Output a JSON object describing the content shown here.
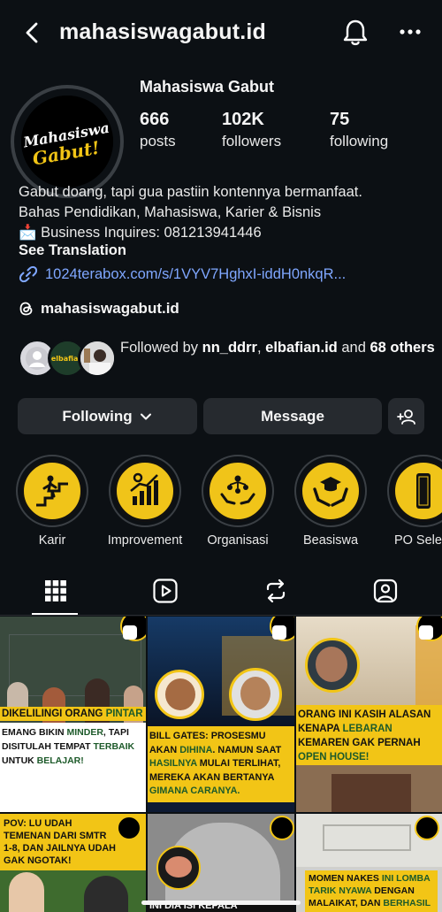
{
  "header": {
    "username": "mahasiswagabut.id"
  },
  "profile": {
    "display_name": "Mahasiswa Gabut",
    "avatar_text_1": "Mahasiswa",
    "avatar_text_2": "Gabut!",
    "stats": [
      {
        "value": "666",
        "label": "posts"
      },
      {
        "value": "102K",
        "label": "followers"
      },
      {
        "value": "75",
        "label": "following"
      }
    ],
    "bio_lines": [
      "Gabut doang, tapi gua pastiin kontennya bermanfaat.",
      "Bahas Pendidikan, Mahasiswa, Karier & Bisnis",
      "📩 Business Inquires: 081213941446"
    ],
    "see_translation": "See Translation",
    "link": "1024terabox.com/s/1VYV7HghxI-iddH0nkqR...",
    "threads_handle": "mahasiswagabut.id",
    "followed_by": {
      "prefix": "Followed by ",
      "user1": "nn_ddrr",
      "sep": ", ",
      "user2": "elbafian.id",
      "and": " and ",
      "others": "68 others",
      "avatar2_text": "elbafian"
    }
  },
  "buttons": {
    "following": "Following",
    "message": "Message"
  },
  "highlights": [
    {
      "label": "Karir",
      "icon": "stairs-climb-icon"
    },
    {
      "label": "Improvement",
      "icon": "growth-chart-icon"
    },
    {
      "label": "Organisasi",
      "icon": "team-hands-icon"
    },
    {
      "label": "Beasiswa",
      "icon": "graduation-hands-icon"
    },
    {
      "label": "PO Selem",
      "icon": "bookmark-ribbon-icon"
    }
  ],
  "tabs": [
    "grid-icon",
    "reels-icon",
    "reposts-icon",
    "tagged-icon"
  ],
  "posts": [
    {
      "caption_a": "DIKELILINGI ORANG ",
      "caption_hl": "PINTAR",
      "caption_b": "EMANG BIKIN ",
      "caption_hl2": "MINDER",
      "caption_c": ", TAPI DISITULAH TEMPAT ",
      "caption_hl3": "TERBAIK",
      "caption_d": " UNTUK ",
      "caption_hl4": "BELAJAR!"
    },
    {
      "caption_a": "BILL GATES: PROSESMU AKAN ",
      "caption_hl": "DIHINA",
      "caption_b": ". NAMUN SAAT ",
      "caption_hl2": "HASILNYA",
      "caption_c": " MULAI TERLIHAT, MEREKA AKAN BERTANYA ",
      "caption_hl3": "GIMANA CARANYA."
    },
    {
      "caption_a": "ORANG INI KASIH ALASAN KENAPA ",
      "caption_hl": "LEBARAN",
      "caption_b": " KEMAREN GAK PERNAH ",
      "caption_hl2": "OPEN HOUSE!"
    },
    {
      "caption": "POV: LU UDAH TEMENAN DARI SMTR 1-8, DAN JAILNYA UDAH GAK NGOTAK!"
    },
    {
      "caption": "INI DIA ISI KEPALA"
    },
    {
      "caption_a": "MOMEN NAKES ",
      "caption_hl": "INI LOMBA TARIK NYAWA",
      "caption_b": " DENGAN MALAIKAT, DAN ",
      "caption_hl2": "BERHASIL"
    }
  ],
  "colors": {
    "accent_yellow": "#f2c516",
    "link_blue": "#7fa7ff",
    "bg": "#0c1014"
  }
}
